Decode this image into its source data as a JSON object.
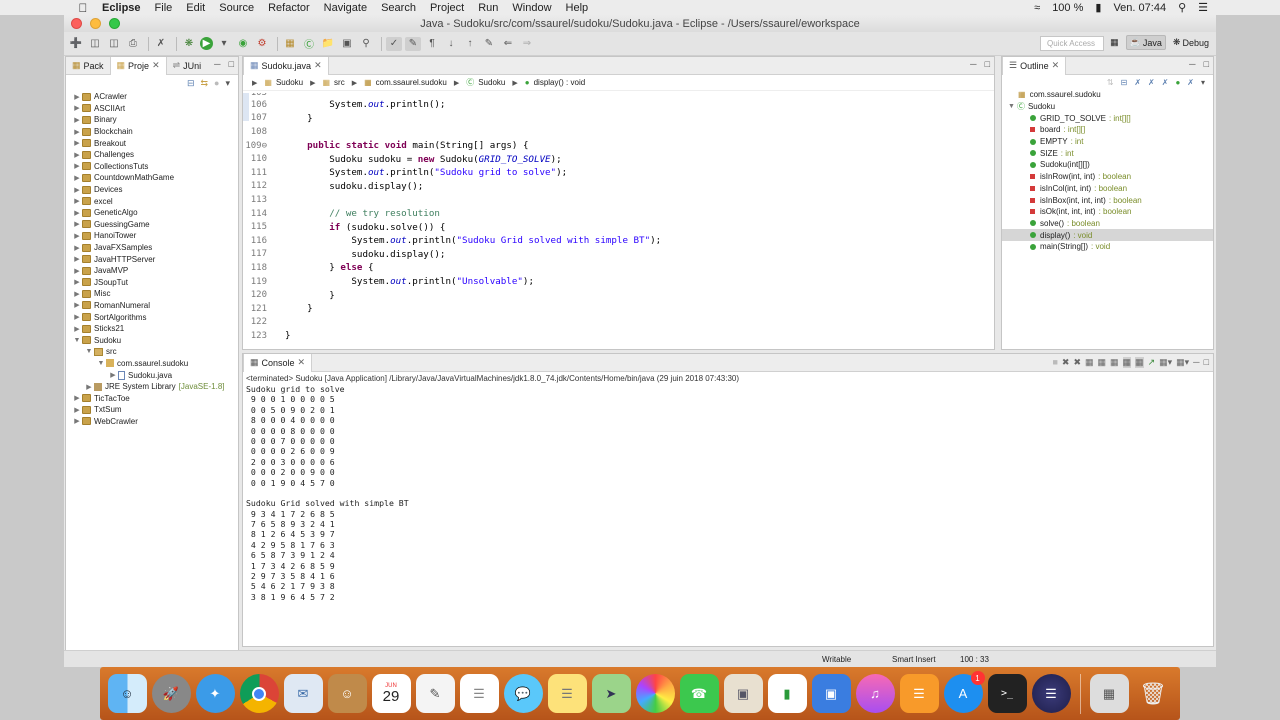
{
  "menubar": {
    "app_name": "Eclipse",
    "menus": [
      "File",
      "Edit",
      "Source",
      "Refactor",
      "Navigate",
      "Search",
      "Project",
      "Run",
      "Window",
      "Help"
    ],
    "battery": "100 %",
    "clock": "Ven. 07:44"
  },
  "window": {
    "title": "Java - Sudoku/src/com/ssaurel/sudoku/Sudoku.java - Eclipse - /Users/ssaurel/eworkspace"
  },
  "toolbar": {
    "quick_access_placeholder": "Quick Access",
    "perspectives": [
      "Java",
      "Debug"
    ]
  },
  "package_explorer": {
    "tabs": [
      "Pack",
      "Proje",
      "JUni"
    ],
    "projects": [
      {
        "label": "ACrawler",
        "expanded": false
      },
      {
        "label": "ASCIIArt",
        "expanded": false
      },
      {
        "label": "Binary",
        "expanded": false
      },
      {
        "label": "Blockchain",
        "expanded": false
      },
      {
        "label": "Breakout",
        "expanded": false
      },
      {
        "label": "Challenges",
        "expanded": false
      },
      {
        "label": "CollectionsTuts",
        "expanded": false
      },
      {
        "label": "CountdownMathGame",
        "expanded": false
      },
      {
        "label": "Devices",
        "expanded": false
      },
      {
        "label": "excel",
        "expanded": false
      },
      {
        "label": "GeneticAlgo",
        "expanded": false
      },
      {
        "label": "GuessingGame",
        "expanded": false
      },
      {
        "label": "HanoiTower",
        "expanded": false
      },
      {
        "label": "JavaFXSamples",
        "expanded": false
      },
      {
        "label": "JavaHTTPServer",
        "expanded": false
      },
      {
        "label": "JavaMVP",
        "expanded": false
      },
      {
        "label": "JSoupTut",
        "expanded": false
      },
      {
        "label": "Misc",
        "expanded": false
      },
      {
        "label": "RomanNumeral",
        "expanded": false
      },
      {
        "label": "SortAlgorithms",
        "expanded": false
      },
      {
        "label": "Sticks21",
        "expanded": false
      },
      {
        "label": "Sudoku",
        "expanded": true
      }
    ],
    "sudoku_children": {
      "src": "src",
      "package": "com.ssaurel.sudoku",
      "file": "Sudoku.java",
      "jre_label": "JRE System Library",
      "jre_version": "[JavaSE-1.8]"
    },
    "projects_after": [
      "TicTacToe",
      "TxtSum",
      "WebCrawler"
    ]
  },
  "editor": {
    "tab_label": "Sudoku.java",
    "breadcrumb": [
      "Sudoku",
      "src",
      "com.ssaurel.sudoku",
      "Sudoku",
      "display() : void"
    ]
  },
  "outline": {
    "tab_label": "Outline",
    "package": "com.ssaurel.sudoku",
    "class": "Sudoku",
    "members": [
      {
        "name": "GRID_TO_SOLVE",
        "type": ": int[][]",
        "marker": "static-final",
        "color": "#3aa33a"
      },
      {
        "name": "board",
        "type": ": int[][]",
        "marker": "private",
        "color": "#d43a3a"
      },
      {
        "name": "EMPTY",
        "type": ": int",
        "marker": "static-final",
        "color": "#3aa33a"
      },
      {
        "name": "SIZE",
        "type": ": int",
        "marker": "static-final",
        "color": "#3aa33a"
      },
      {
        "name": "Sudoku(int[][])",
        "type": "",
        "marker": "constructor",
        "color": "#3aa33a"
      },
      {
        "name": "isInRow(int, int)",
        "type": ": boolean",
        "marker": "private",
        "color": "#d43a3a"
      },
      {
        "name": "isInCol(int, int)",
        "type": ": boolean",
        "marker": "private",
        "color": "#d43a3a"
      },
      {
        "name": "isInBox(int, int, int)",
        "type": ": boolean",
        "marker": "private",
        "color": "#d43a3a"
      },
      {
        "name": "isOk(int, int, int)",
        "type": ": boolean",
        "marker": "private",
        "color": "#d43a3a"
      },
      {
        "name": "solve()",
        "type": ": boolean",
        "marker": "public",
        "color": "#3aa33a"
      },
      {
        "name": "display()",
        "type": ": void",
        "marker": "public",
        "color": "#3aa33a",
        "selected": true
      },
      {
        "name": "main(String[])",
        "type": ": void",
        "marker": "static",
        "color": "#3aa33a"
      }
    ]
  },
  "console": {
    "tab_label": "Console",
    "header": "<terminated> Sudoku [Java Application] /Library/Java/JavaVirtualMachines/jdk1.8.0_74.jdk/Contents/Home/bin/java (29 juin 2018 07:43:30)",
    "lines": [
      "Sudoku grid to solve",
      " 9 0 0 1 0 0 0 0 5",
      " 0 0 5 0 9 0 2 0 1",
      " 8 0 0 0 4 0 0 0 0",
      " 0 0 0 0 8 0 0 0 0",
      " 0 0 0 7 0 0 0 0 0",
      " 0 0 0 0 2 6 0 0 9",
      " 2 0 0 3 0 0 0 0 6",
      " 0 0 0 2 0 0 9 0 0",
      " 0 0 1 9 0 4 5 7 0",
      "",
      "Sudoku Grid solved with simple BT",
      " 9 3 4 1 7 2 6 8 5",
      " 7 6 5 8 9 3 2 4 1",
      " 8 1 2 6 4 5 3 9 7",
      " 4 2 9 5 8 1 7 6 3",
      " 6 5 8 7 3 9 1 2 4",
      " 1 7 3 4 2 6 8 5 9",
      " 2 9 7 3 5 8 4 1 6",
      " 5 4 6 2 1 7 9 3 8",
      " 3 8 1 9 6 4 5 7 2"
    ]
  },
  "statusbar": {
    "writable": "Writable",
    "insert_mode": "Smart Insert",
    "position": "100 : 33"
  },
  "dock": {
    "calendar_month": "JUN",
    "calendar_day": "29",
    "app_store_badge": "1"
  }
}
